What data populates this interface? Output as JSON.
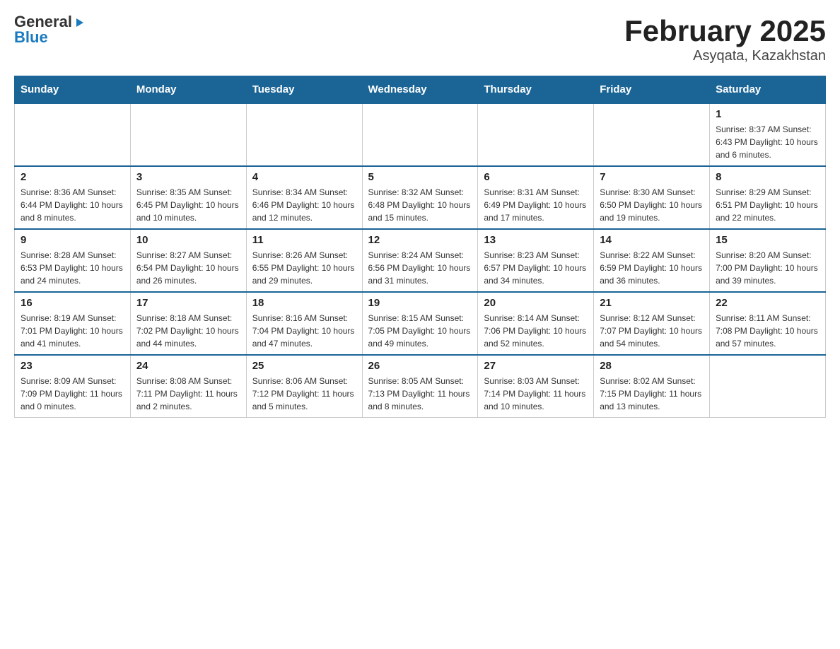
{
  "header": {
    "logo": {
      "general": "General",
      "blue": "Blue",
      "triangle": "▶"
    },
    "title": "February 2025",
    "location": "Asyqata, Kazakhstan"
  },
  "weekdays": [
    "Sunday",
    "Monday",
    "Tuesday",
    "Wednesday",
    "Thursday",
    "Friday",
    "Saturday"
  ],
  "weeks": [
    [
      {
        "day": "",
        "info": ""
      },
      {
        "day": "",
        "info": ""
      },
      {
        "day": "",
        "info": ""
      },
      {
        "day": "",
        "info": ""
      },
      {
        "day": "",
        "info": ""
      },
      {
        "day": "",
        "info": ""
      },
      {
        "day": "1",
        "info": "Sunrise: 8:37 AM\nSunset: 6:43 PM\nDaylight: 10 hours and 6 minutes."
      }
    ],
    [
      {
        "day": "2",
        "info": "Sunrise: 8:36 AM\nSunset: 6:44 PM\nDaylight: 10 hours and 8 minutes."
      },
      {
        "day": "3",
        "info": "Sunrise: 8:35 AM\nSunset: 6:45 PM\nDaylight: 10 hours and 10 minutes."
      },
      {
        "day": "4",
        "info": "Sunrise: 8:34 AM\nSunset: 6:46 PM\nDaylight: 10 hours and 12 minutes."
      },
      {
        "day": "5",
        "info": "Sunrise: 8:32 AM\nSunset: 6:48 PM\nDaylight: 10 hours and 15 minutes."
      },
      {
        "day": "6",
        "info": "Sunrise: 8:31 AM\nSunset: 6:49 PM\nDaylight: 10 hours and 17 minutes."
      },
      {
        "day": "7",
        "info": "Sunrise: 8:30 AM\nSunset: 6:50 PM\nDaylight: 10 hours and 19 minutes."
      },
      {
        "day": "8",
        "info": "Sunrise: 8:29 AM\nSunset: 6:51 PM\nDaylight: 10 hours and 22 minutes."
      }
    ],
    [
      {
        "day": "9",
        "info": "Sunrise: 8:28 AM\nSunset: 6:53 PM\nDaylight: 10 hours and 24 minutes."
      },
      {
        "day": "10",
        "info": "Sunrise: 8:27 AM\nSunset: 6:54 PM\nDaylight: 10 hours and 26 minutes."
      },
      {
        "day": "11",
        "info": "Sunrise: 8:26 AM\nSunset: 6:55 PM\nDaylight: 10 hours and 29 minutes."
      },
      {
        "day": "12",
        "info": "Sunrise: 8:24 AM\nSunset: 6:56 PM\nDaylight: 10 hours and 31 minutes."
      },
      {
        "day": "13",
        "info": "Sunrise: 8:23 AM\nSunset: 6:57 PM\nDaylight: 10 hours and 34 minutes."
      },
      {
        "day": "14",
        "info": "Sunrise: 8:22 AM\nSunset: 6:59 PM\nDaylight: 10 hours and 36 minutes."
      },
      {
        "day": "15",
        "info": "Sunrise: 8:20 AM\nSunset: 7:00 PM\nDaylight: 10 hours and 39 minutes."
      }
    ],
    [
      {
        "day": "16",
        "info": "Sunrise: 8:19 AM\nSunset: 7:01 PM\nDaylight: 10 hours and 41 minutes."
      },
      {
        "day": "17",
        "info": "Sunrise: 8:18 AM\nSunset: 7:02 PM\nDaylight: 10 hours and 44 minutes."
      },
      {
        "day": "18",
        "info": "Sunrise: 8:16 AM\nSunset: 7:04 PM\nDaylight: 10 hours and 47 minutes."
      },
      {
        "day": "19",
        "info": "Sunrise: 8:15 AM\nSunset: 7:05 PM\nDaylight: 10 hours and 49 minutes."
      },
      {
        "day": "20",
        "info": "Sunrise: 8:14 AM\nSunset: 7:06 PM\nDaylight: 10 hours and 52 minutes."
      },
      {
        "day": "21",
        "info": "Sunrise: 8:12 AM\nSunset: 7:07 PM\nDaylight: 10 hours and 54 minutes."
      },
      {
        "day": "22",
        "info": "Sunrise: 8:11 AM\nSunset: 7:08 PM\nDaylight: 10 hours and 57 minutes."
      }
    ],
    [
      {
        "day": "23",
        "info": "Sunrise: 8:09 AM\nSunset: 7:09 PM\nDaylight: 11 hours and 0 minutes."
      },
      {
        "day": "24",
        "info": "Sunrise: 8:08 AM\nSunset: 7:11 PM\nDaylight: 11 hours and 2 minutes."
      },
      {
        "day": "25",
        "info": "Sunrise: 8:06 AM\nSunset: 7:12 PM\nDaylight: 11 hours and 5 minutes."
      },
      {
        "day": "26",
        "info": "Sunrise: 8:05 AM\nSunset: 7:13 PM\nDaylight: 11 hours and 8 minutes."
      },
      {
        "day": "27",
        "info": "Sunrise: 8:03 AM\nSunset: 7:14 PM\nDaylight: 11 hours and 10 minutes."
      },
      {
        "day": "28",
        "info": "Sunrise: 8:02 AM\nSunset: 7:15 PM\nDaylight: 11 hours and 13 minutes."
      },
      {
        "day": "",
        "info": ""
      }
    ]
  ]
}
